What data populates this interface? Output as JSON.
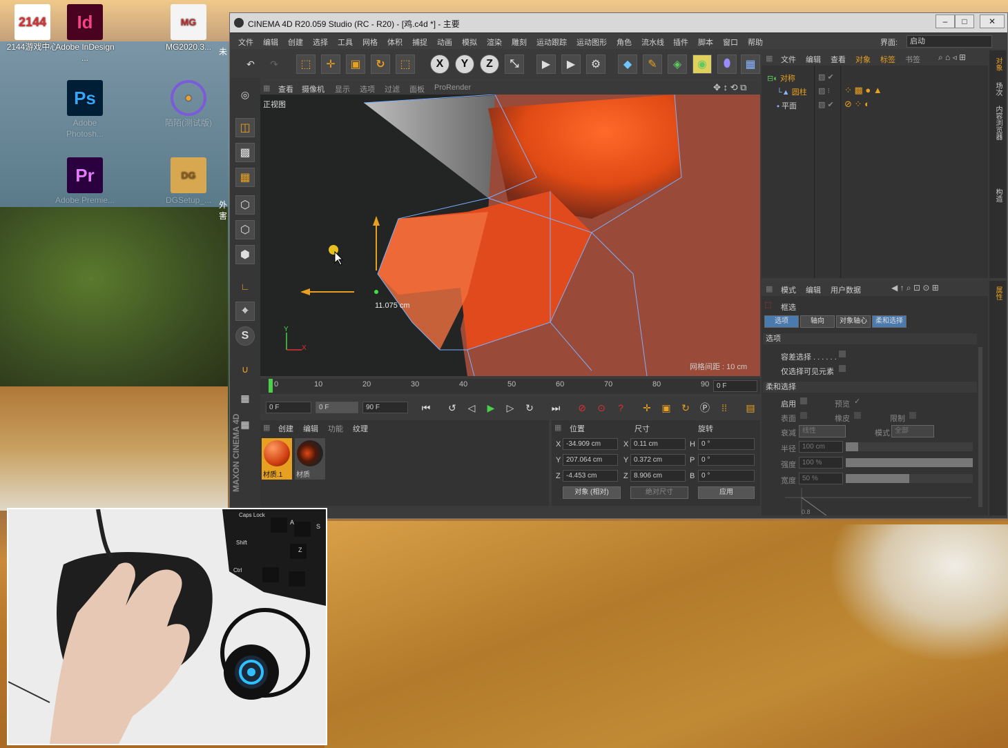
{
  "desktop_icons": [
    {
      "name": "2144game-icon",
      "label": "2144游戏中心",
      "glyph": "2144",
      "color": "#e03030"
    },
    {
      "name": "indesign-icon",
      "label": "Adobe InDesign ...",
      "glyph": "Id",
      "color": "#49021f"
    },
    {
      "name": "mg2020-icon",
      "label": "MG2020.3...",
      "glyph": "MG",
      "color": "#eeeeee"
    },
    {
      "name": "photoshop-icon",
      "label": "Adobe Photosh...",
      "glyph": "Ps",
      "color": "#001e36"
    },
    {
      "name": "chat-icon",
      "label": "陌陌(测试版)",
      "glyph": "•",
      "color": "#7b5bd8"
    },
    {
      "name": "premiere-icon",
      "label": "Adobe Premie...",
      "glyph": "Pr",
      "color": "#2a003f"
    },
    {
      "name": "dgsetup-icon",
      "label": "DGSetup_...",
      "glyph": "DG",
      "color": "#d8a850"
    }
  ],
  "side_cut_labels": [
    "未",
    "外",
    "害"
  ],
  "app": {
    "title": "CINEMA 4D R20.059 Studio (RC - R20) - [鸡.c4d *] - 主要",
    "menu": [
      "文件",
      "编辑",
      "创建",
      "选择",
      "工具",
      "网格",
      "体积",
      "捕捉",
      "动画",
      "模拟",
      "渲染",
      "雕刻",
      "运动跟踪",
      "运动图形",
      "角色",
      "流水线",
      "插件",
      "脚本",
      "窗口",
      "帮助"
    ],
    "layout_label": "界面:",
    "layout_value": "启动"
  },
  "viewport": {
    "menu": [
      "查看",
      "摄像机",
      "显示",
      "选项",
      "过滤",
      "面板",
      "ProRender"
    ],
    "view_name": "正视图",
    "measure": "11.075 cm",
    "grid_spacing": "网格间距 : 10 cm",
    "axis_y": "Y",
    "axis_x": "X"
  },
  "timeline": {
    "ticks": [
      "0",
      "10",
      "20",
      "30",
      "40",
      "50",
      "60",
      "70",
      "80",
      "90"
    ],
    "current_frame": "0 F",
    "start": "0 F",
    "preview_start": "0 F",
    "end": "90 F"
  },
  "material_manager": {
    "menu": [
      "创建",
      "编辑",
      "功能",
      "纹理"
    ],
    "materials": [
      {
        "label": "材质.1",
        "selected": true
      },
      {
        "label": "材质",
        "selected": false
      }
    ]
  },
  "coordinates": {
    "headers": [
      "位置",
      "尺寸",
      "旋转"
    ],
    "rows": [
      {
        "axis": "X",
        "pos": "-34.909 cm",
        "size_axis": "X",
        "size": "0.11 cm",
        "rot_axis": "H",
        "rot": "0 °"
      },
      {
        "axis": "Y",
        "pos": "207.064 cm",
        "size_axis": "Y",
        "size": "0.372 cm",
        "rot_axis": "P",
        "rot": "0 °"
      },
      {
        "axis": "Z",
        "pos": "-4.453 cm",
        "size_axis": "Z",
        "size": "8.906 cm",
        "rot_axis": "B",
        "rot": "0 °"
      }
    ],
    "mode": "对象 (相对)",
    "size_mode": "绝对尺寸",
    "apply": "应用"
  },
  "object_manager": {
    "menu": [
      "文件",
      "编辑",
      "查看",
      "对象",
      "标签",
      "书签"
    ],
    "objects": [
      {
        "name": "对称",
        "color": "#e8a020"
      },
      {
        "name": "圆柱",
        "color": "#e8a020"
      },
      {
        "name": "平面",
        "color": "#bcbcbc"
      }
    ]
  },
  "side_tabs": [
    "对象",
    "场次",
    "内容浏览器",
    "构造"
  ],
  "attributes": {
    "menu": [
      "模式",
      "编辑",
      "用户数据"
    ],
    "tool_name": "框选",
    "tabs": [
      "选项",
      "轴向",
      "对象轴心",
      "柔和选择"
    ],
    "section_options": "选项",
    "tolerant": "容差选择 . . . . . .",
    "visible_only": "仅选择可见元素",
    "section_soft": "柔和选择",
    "enable": "启用",
    "preview": "预览",
    "surface": "表面",
    "rubber": "橡皮",
    "restrict": "限制",
    "falloff": "衰减",
    "falloff_val": "线性",
    "mode": "模式",
    "mode_val": "全部",
    "radius": "半径",
    "radius_val": "100 cm",
    "strength": "强度",
    "strength_val": "100 %",
    "width": "宽度",
    "width_val": "50 %",
    "graph_label": "0.8"
  },
  "right_tab": "属性",
  "keyboard": {
    "caps": "Caps Lock",
    "a": "A",
    "s": "S",
    "shift": "Shift",
    "z": "Z",
    "ctrl": "Ctrl"
  },
  "logo": "MAXON CINEMA 4D"
}
